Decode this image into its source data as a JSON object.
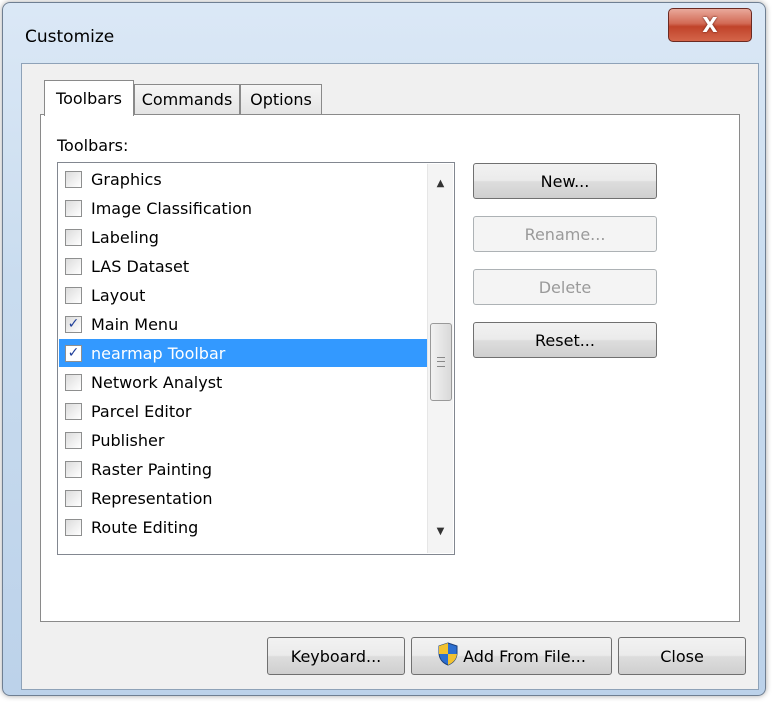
{
  "window": {
    "title": "Customize",
    "close_label": "X"
  },
  "tabs": [
    {
      "label": "Toolbars",
      "active": true
    },
    {
      "label": "Commands",
      "active": false
    },
    {
      "label": "Options",
      "active": false
    }
  ],
  "toolbars_section": {
    "label": "Toolbars:",
    "items": [
      {
        "label": "Graphics",
        "checked": false,
        "selected": false
      },
      {
        "label": "Image Classification",
        "checked": false,
        "selected": false
      },
      {
        "label": "Labeling",
        "checked": false,
        "selected": false
      },
      {
        "label": "LAS Dataset",
        "checked": false,
        "selected": false
      },
      {
        "label": "Layout",
        "checked": false,
        "selected": false
      },
      {
        "label": "Main Menu",
        "checked": true,
        "selected": false
      },
      {
        "label": "nearmap Toolbar",
        "checked": true,
        "selected": true
      },
      {
        "label": "Network Analyst",
        "checked": false,
        "selected": false
      },
      {
        "label": "Parcel Editor",
        "checked": false,
        "selected": false
      },
      {
        "label": "Publisher",
        "checked": false,
        "selected": false
      },
      {
        "label": "Raster Painting",
        "checked": false,
        "selected": false
      },
      {
        "label": "Representation",
        "checked": false,
        "selected": false
      },
      {
        "label": "Route Editing",
        "checked": false,
        "selected": false
      }
    ]
  },
  "side_buttons": {
    "new": {
      "label": "New...",
      "enabled": true
    },
    "rename": {
      "label": "Rename...",
      "enabled": false
    },
    "delete": {
      "label": "Delete",
      "enabled": false
    },
    "reset": {
      "label": "Reset...",
      "enabled": true
    }
  },
  "bottom_buttons": {
    "keyboard": "Keyboard...",
    "add_from_file": "Add From File...",
    "close": "Close"
  },
  "icons": {
    "checkmark": "check-icon",
    "scroll_up": "scroll-up-arrow-icon",
    "scroll_down": "scroll-down-arrow-icon",
    "shield": "uac-shield-icon"
  },
  "colors": {
    "selection": "#3399ff",
    "close_button": "#c0432a",
    "window_frame": "#c9dcef"
  }
}
